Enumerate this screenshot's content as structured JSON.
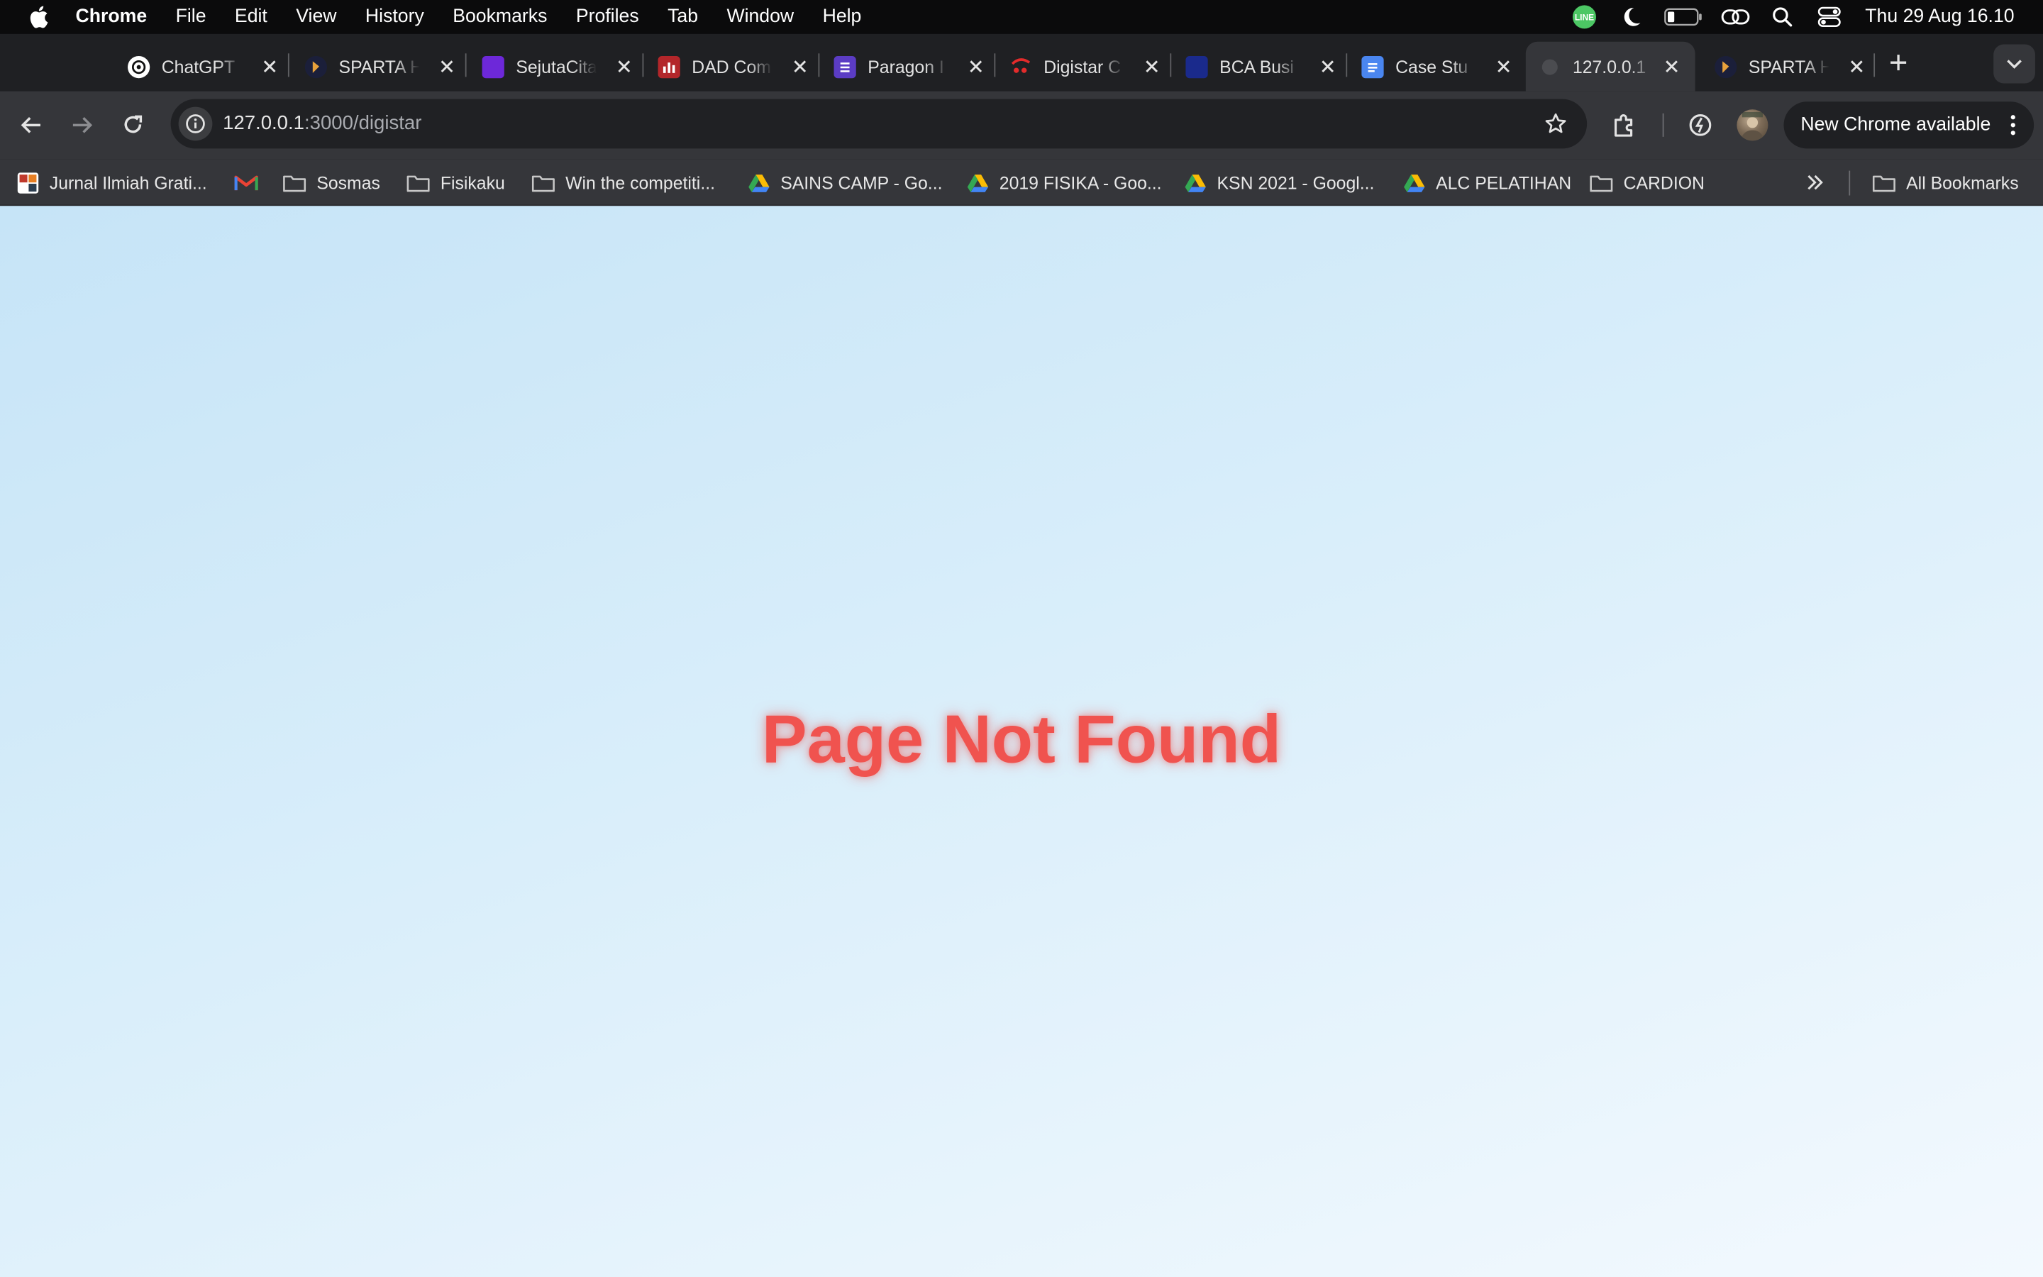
{
  "menubar": {
    "app": "Chrome",
    "items": [
      "File",
      "Edit",
      "View",
      "History",
      "Bookmarks",
      "Profiles",
      "Tab",
      "Window",
      "Help"
    ],
    "system_icons": [
      "line-icon",
      "moon-icon",
      "battery-icon",
      "link-icon",
      "spotlight-search-icon",
      "control-center-icon"
    ],
    "line_badge": "LINE",
    "clock": "Thu 29 Aug  16.10"
  },
  "tabs": [
    {
      "title": "ChatGPT",
      "icon": "chatgpt-icon"
    },
    {
      "title": "SPARTA H",
      "icon": "sparta-icon"
    },
    {
      "title": "SejutaCita",
      "icon": "sejutacita-icon"
    },
    {
      "title": "DAD Com",
      "icon": "dad-icon"
    },
    {
      "title": "Paragon I",
      "icon": "paragon-icon"
    },
    {
      "title": "Digistar C",
      "icon": "digistar-icon"
    },
    {
      "title": "BCA Busi",
      "icon": "bca-icon"
    },
    {
      "title": "Case Stu",
      "icon": "docs-icon"
    },
    {
      "title": "127.0.0.1",
      "icon": "globe-icon",
      "active": true
    },
    {
      "title": "SPARTA H",
      "icon": "sparta-icon"
    }
  ],
  "toolbar": {
    "url_host": "127.0.0.1",
    "url_path": ":3000/digistar",
    "update_label": "New Chrome available"
  },
  "bookmarks": [
    {
      "label": "Jurnal Ilmiah Grati...",
      "icon": "journal-icon"
    },
    {
      "label": "",
      "icon": "gmail-icon"
    },
    {
      "label": "Sosmas",
      "icon": "folder-icon"
    },
    {
      "label": "Fisikaku",
      "icon": "folder-icon"
    },
    {
      "label": "Win the competiti...",
      "icon": "folder-icon"
    },
    {
      "label": "SAINS CAMP - Go...",
      "icon": "drive-icon"
    },
    {
      "label": "2019 FISIKA - Goo...",
      "icon": "drive-icon"
    },
    {
      "label": "KSN 2021 - Googl...",
      "icon": "drive-icon"
    },
    {
      "label": "ALC PELATIHAN",
      "icon": "drive-icon"
    },
    {
      "label": "CARDION",
      "icon": "folder-icon"
    }
  ],
  "all_bookmarks": "All Bookmarks",
  "page": {
    "message": "Page Not Found"
  },
  "colors": {
    "message": "#f0534f",
    "background_start": "#c6e4f7",
    "background_end": "#f3f9fe",
    "chrome_dark": "#35363a"
  }
}
